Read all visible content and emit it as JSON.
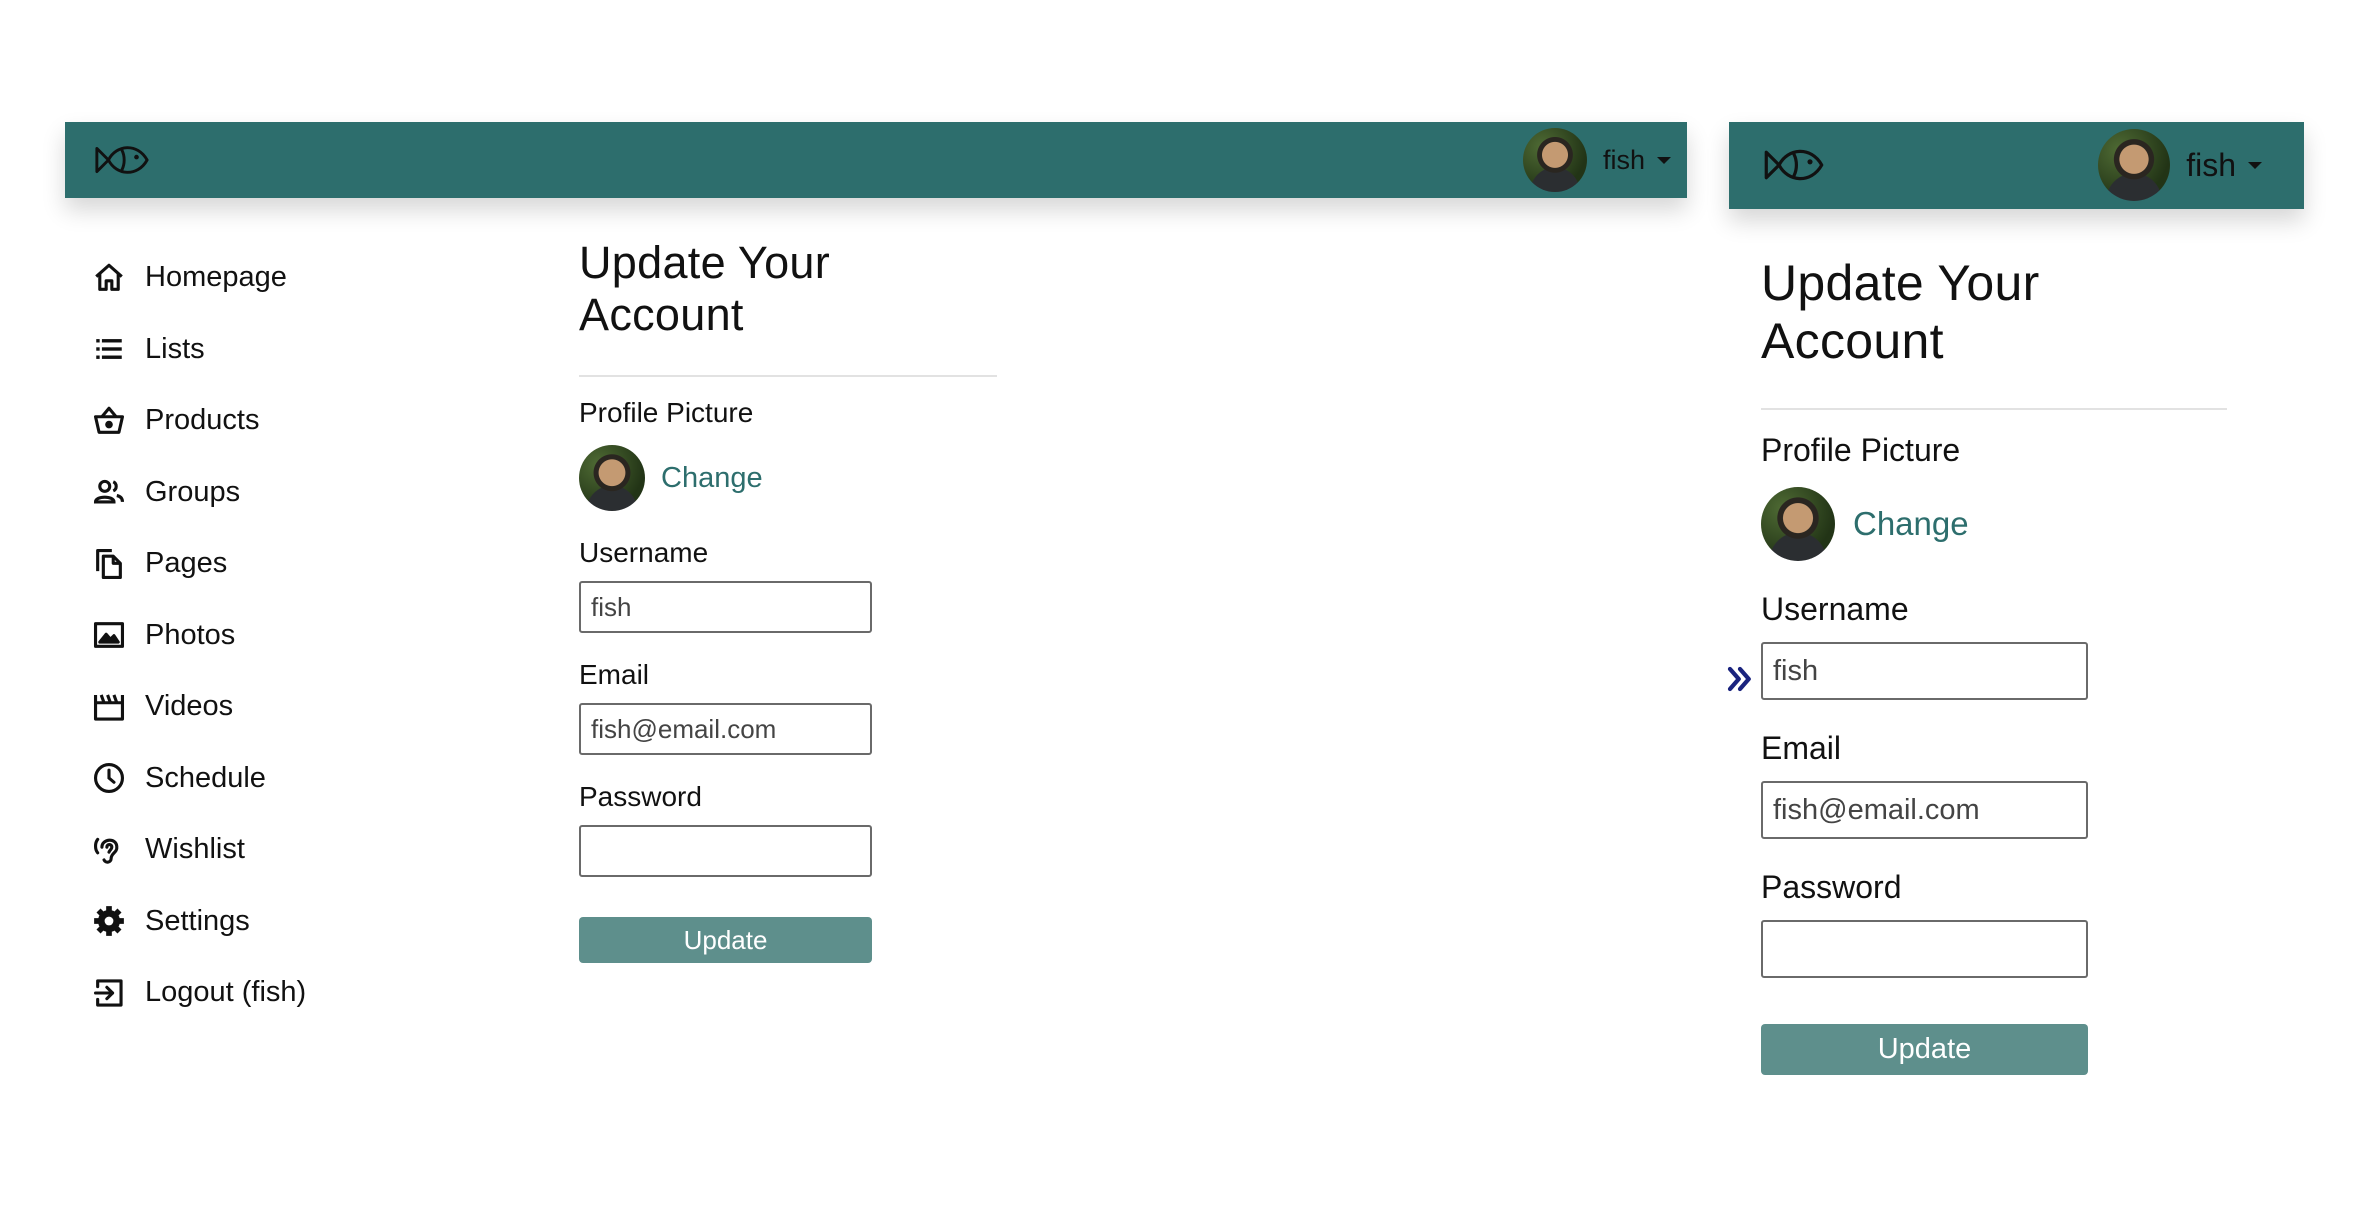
{
  "app": {
    "username": "fish"
  },
  "sidebar": {
    "items": [
      {
        "label": "Homepage",
        "icon": "home-icon"
      },
      {
        "label": "Lists",
        "icon": "list-icon"
      },
      {
        "label": "Products",
        "icon": "basket-icon"
      },
      {
        "label": "Groups",
        "icon": "groups-icon"
      },
      {
        "label": "Pages",
        "icon": "pages-icon"
      },
      {
        "label": "Photos",
        "icon": "photo-icon"
      },
      {
        "label": "Videos",
        "icon": "video-icon"
      },
      {
        "label": "Schedule",
        "icon": "clock-icon"
      },
      {
        "label": "Wishlist",
        "icon": "ear-icon"
      },
      {
        "label": "Settings",
        "icon": "gear-icon"
      },
      {
        "label": "Logout (fish)",
        "icon": "logout-icon"
      }
    ]
  },
  "form": {
    "title": "Update Your Account",
    "profile_picture_label": "Profile Picture",
    "change_link": "Change",
    "username_label": "Username",
    "username_value": "fish",
    "email_label": "Email",
    "email_value": "fish@email.com",
    "password_label": "Password",
    "password_value": "",
    "submit_label": "Update"
  },
  "colors": {
    "header": "#2d6e6d",
    "button": "#5e8f8c",
    "link": "#2d6e6d",
    "collapse_icon": "#1a237e"
  }
}
